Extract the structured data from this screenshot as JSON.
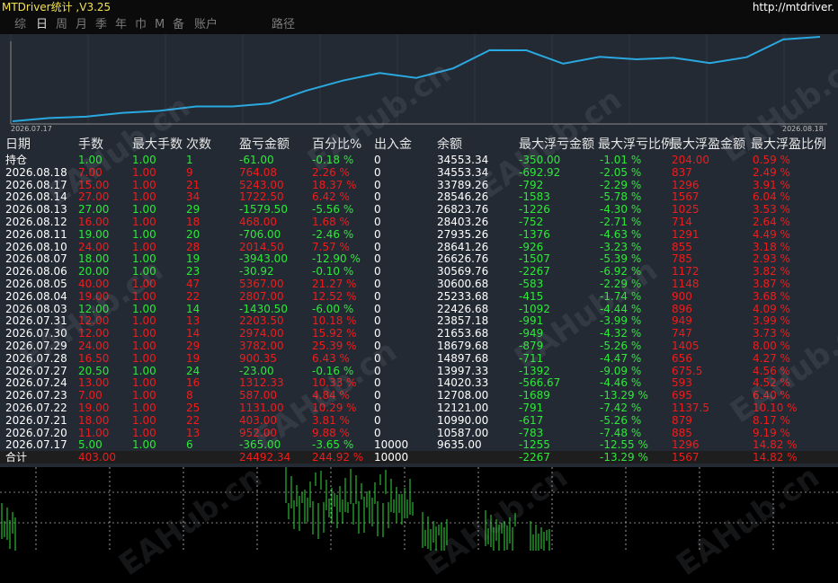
{
  "title": "MTDriver统计 ,V3.25",
  "url": "http://mtdriver.",
  "tabs": [
    "综",
    "日",
    "周",
    "月",
    "季",
    "年",
    "巾",
    "M",
    "备",
    "账户",
    "路径"
  ],
  "active_tab": 1,
  "curve": {
    "start_date": "2026.07.17",
    "end_date": "2026.08.18"
  },
  "columns": [
    "日期",
    "手数",
    "最大手数",
    "次数",
    "盈亏金额",
    "百分比%",
    "出入金",
    "余额",
    "最大浮亏金额",
    "最大浮亏比例",
    "最大浮盈金额",
    "最大浮盈比例"
  ],
  "rows": [
    [
      "持仓",
      "1.00",
      "1.00",
      "1",
      "-61.00",
      "-0.18 %",
      "0",
      "34553.34",
      "-350.00",
      "-1.01 %",
      "204.00",
      "0.59 %"
    ],
    [
      "2026.08.18",
      "7.00",
      "1.00",
      "9",
      "764.08",
      "2.26 %",
      "0",
      "34553.34",
      "-692.92",
      "-2.05 %",
      "837",
      "2.49 %"
    ],
    [
      "2026.08.17",
      "15.00",
      "1.00",
      "21",
      "5243.00",
      "18.37 %",
      "0",
      "33789.26",
      "-792",
      "-2.29 %",
      "1296",
      "3.91 %"
    ],
    [
      "2026.08.14",
      "27.00",
      "1.00",
      "34",
      "1722.50",
      "6.42 %",
      "0",
      "28546.26",
      "-1583",
      "-5.78 %",
      "1567",
      "6.04 %"
    ],
    [
      "2026.08.13",
      "27.00",
      "1.00",
      "29",
      "-1579.50",
      "-5.56 %",
      "0",
      "26823.76",
      "-1226",
      "-4.30 %",
      "1025",
      "3.53 %"
    ],
    [
      "2026.08.12",
      "16.00",
      "1.00",
      "18",
      "468.00",
      "1.68 %",
      "0",
      "28403.26",
      "-752",
      "-2.71 %",
      "714",
      "2.64 %"
    ],
    [
      "2026.08.11",
      "19.00",
      "1.00",
      "20",
      "-706.00",
      "-2.46 %",
      "0",
      "27935.26",
      "-1376",
      "-4.63 %",
      "1291",
      "4.49 %"
    ],
    [
      "2026.08.10",
      "24.00",
      "1.00",
      "28",
      "2014.50",
      "7.57 %",
      "0",
      "28641.26",
      "-926",
      "-3.23 %",
      "855",
      "3.18 %"
    ],
    [
      "2026.08.07",
      "18.00",
      "1.00",
      "19",
      "-3943.00",
      "-12.90 %",
      "0",
      "26626.76",
      "-1507",
      "-5.39 %",
      "785",
      "2.93 %"
    ],
    [
      "2026.08.06",
      "20.00",
      "1.00",
      "23",
      "-30.92",
      "-0.10 %",
      "0",
      "30569.76",
      "-2267",
      "-6.92 %",
      "1172",
      "3.82 %"
    ],
    [
      "2026.08.05",
      "40.00",
      "1.00",
      "47",
      "5367.00",
      "21.27 %",
      "0",
      "30600.68",
      "-583",
      "-2.29 %",
      "1148",
      "3.87 %"
    ],
    [
      "2026.08.04",
      "19.00",
      "1.00",
      "22",
      "2807.00",
      "12.52 %",
      "0",
      "25233.68",
      "-415",
      "-1.74 %",
      "900",
      "3.68 %"
    ],
    [
      "2026.08.03",
      "12.00",
      "1.00",
      "14",
      "-1430.50",
      "-6.00 %",
      "0",
      "22426.68",
      "-1092",
      "-4.44 %",
      "896",
      "4.09 %"
    ],
    [
      "2026.07.31",
      "12.00",
      "1.00",
      "13",
      "2203.50",
      "10.18 %",
      "0",
      "23857.18",
      "-991",
      "-3.99 %",
      "949",
      "3.99 %"
    ],
    [
      "2026.07.30",
      "12.00",
      "1.00",
      "14",
      "2974.00",
      "15.92 %",
      "0",
      "21653.68",
      "-949",
      "-4.32 %",
      "747",
      "3.73 %"
    ],
    [
      "2026.07.29",
      "24.00",
      "1.00",
      "29",
      "3782.00",
      "25.39 %",
      "0",
      "18679.68",
      "-879",
      "-5.26 %",
      "1405",
      "8.00 %"
    ],
    [
      "2026.07.28",
      "16.50",
      "1.00",
      "19",
      "900.35",
      "6.43 %",
      "0",
      "14897.68",
      "-711",
      "-4.47 %",
      "656",
      "4.27 %"
    ],
    [
      "2026.07.27",
      "20.50",
      "1.00",
      "24",
      "-23.00",
      "-0.16 %",
      "0",
      "13997.33",
      "-1392",
      "-9.09 %",
      "675.5",
      "4.56 %"
    ],
    [
      "2026.07.24",
      "13.00",
      "1.00",
      "16",
      "1312.33",
      "10.33 %",
      "0",
      "14020.33",
      "-566.67",
      "-4.46 %",
      "593",
      "4.52 %"
    ],
    [
      "2026.07.23",
      "7.00",
      "1.00",
      "8",
      "587.00",
      "4.84 %",
      "0",
      "12708.00",
      "-1689",
      "-13.29 %",
      "695",
      "6.40 %"
    ],
    [
      "2026.07.22",
      "19.00",
      "1.00",
      "25",
      "1131.00",
      "10.29 %",
      "0",
      "12121.00",
      "-791",
      "-7.42 %",
      "1137.5",
      "10.10 %"
    ],
    [
      "2026.07.21",
      "18.00",
      "1.00",
      "22",
      "403.00",
      "3.81 %",
      "0",
      "10990.00",
      "-617",
      "-5.26 %",
      "879",
      "8.17 %"
    ],
    [
      "2026.07.20",
      "11.00",
      "1.00",
      "13",
      "952.00",
      "9.88 %",
      "0",
      "10587.00",
      "-783",
      "-7.48 %",
      "885",
      "9.19 %"
    ],
    [
      "2026.07.17",
      "5.00",
      "1.00",
      "6",
      "-365.00",
      "-3.65 %",
      "10000",
      "9635.00",
      "-1255",
      "-12.55 %",
      "1296",
      "14.82 %"
    ]
  ],
  "total": [
    "合计",
    "403.00",
    "",
    "",
    "24492.34",
    "244.92 %",
    "10000",
    "",
    "-2267",
    "-13.29 %",
    "1567",
    "14.82 %"
  ],
  "watermark": "EAHub.cn",
  "colors": {
    "title": "#f3e24d",
    "panel": "#242a33",
    "curve": "#2aa8e0",
    "positive": "#ef1c1c",
    "negative": "#2ee83a",
    "neutral": "#ffffff",
    "header": "#e6e6e6",
    "candle": "#2fdc3a"
  }
}
